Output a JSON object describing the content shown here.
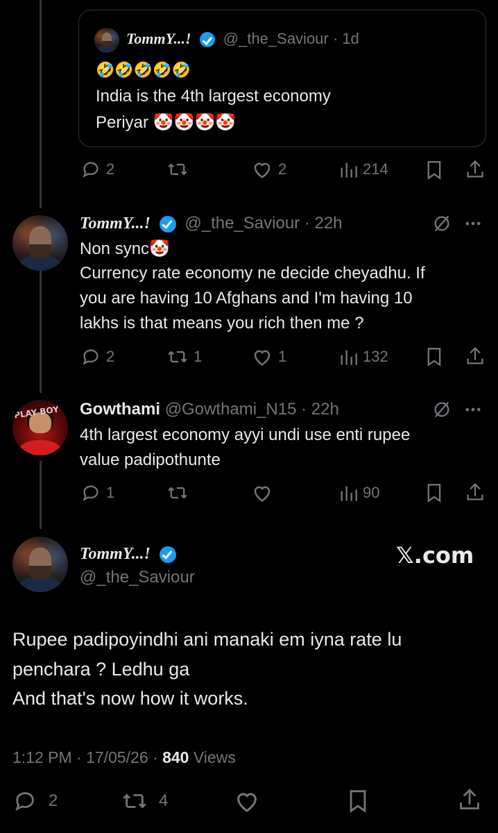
{
  "quote": {
    "name": "TommY...!",
    "handle": "@_the_Saviour",
    "time": "· 1d",
    "emoji_line": "🤣🤣🤣🤣🤣",
    "line1": "India is the 4th largest economy",
    "line2": "Periyar 🤡🤡🤡🤡",
    "replies": "2",
    "reposts": "",
    "likes": "2",
    "views": "214"
  },
  "reply1": {
    "name": "TommY...!",
    "handle": "@_the_Saviour",
    "time": "· 22h",
    "line1": "Non sync🤡",
    "line2": "Currency rate economy ne decide cheyadhu. If",
    "line3": "you are having 10 Afghans and I'm having 10",
    "line4": "lakhs is that means you rich then me ?",
    "replies": "2",
    "reposts": "1",
    "likes": "1",
    "views": "132"
  },
  "reply2": {
    "name": "Gowthami",
    "handle": "@Gowthami_N15",
    "time": "· 22h",
    "avatar_text": "PLAY BOY",
    "line1": "4th largest economy ayyi undi use enti rupee",
    "line2": "value padipothunte",
    "replies": "1",
    "reposts": "",
    "likes": "",
    "views": "90"
  },
  "main": {
    "name": "TommY...!",
    "handle": "@_the_Saviour",
    "watermark": "𝕏.com",
    "line1": "Rupee padipoyindhi ani manaki em iyna rate lu",
    "line2": "penchara ? Ledhu ga",
    "line3": "And that's now how it works.",
    "timestamp": "1:12 PM · 17/05/26 · ",
    "views_count": "840",
    "views_label": " Views",
    "replies": "2",
    "reposts": "4"
  },
  "colors": {
    "background": "#000000",
    "text": "#e7e9ea",
    "muted": "#71767b",
    "verified": "#1d9bf0",
    "border": "#2f3336"
  }
}
